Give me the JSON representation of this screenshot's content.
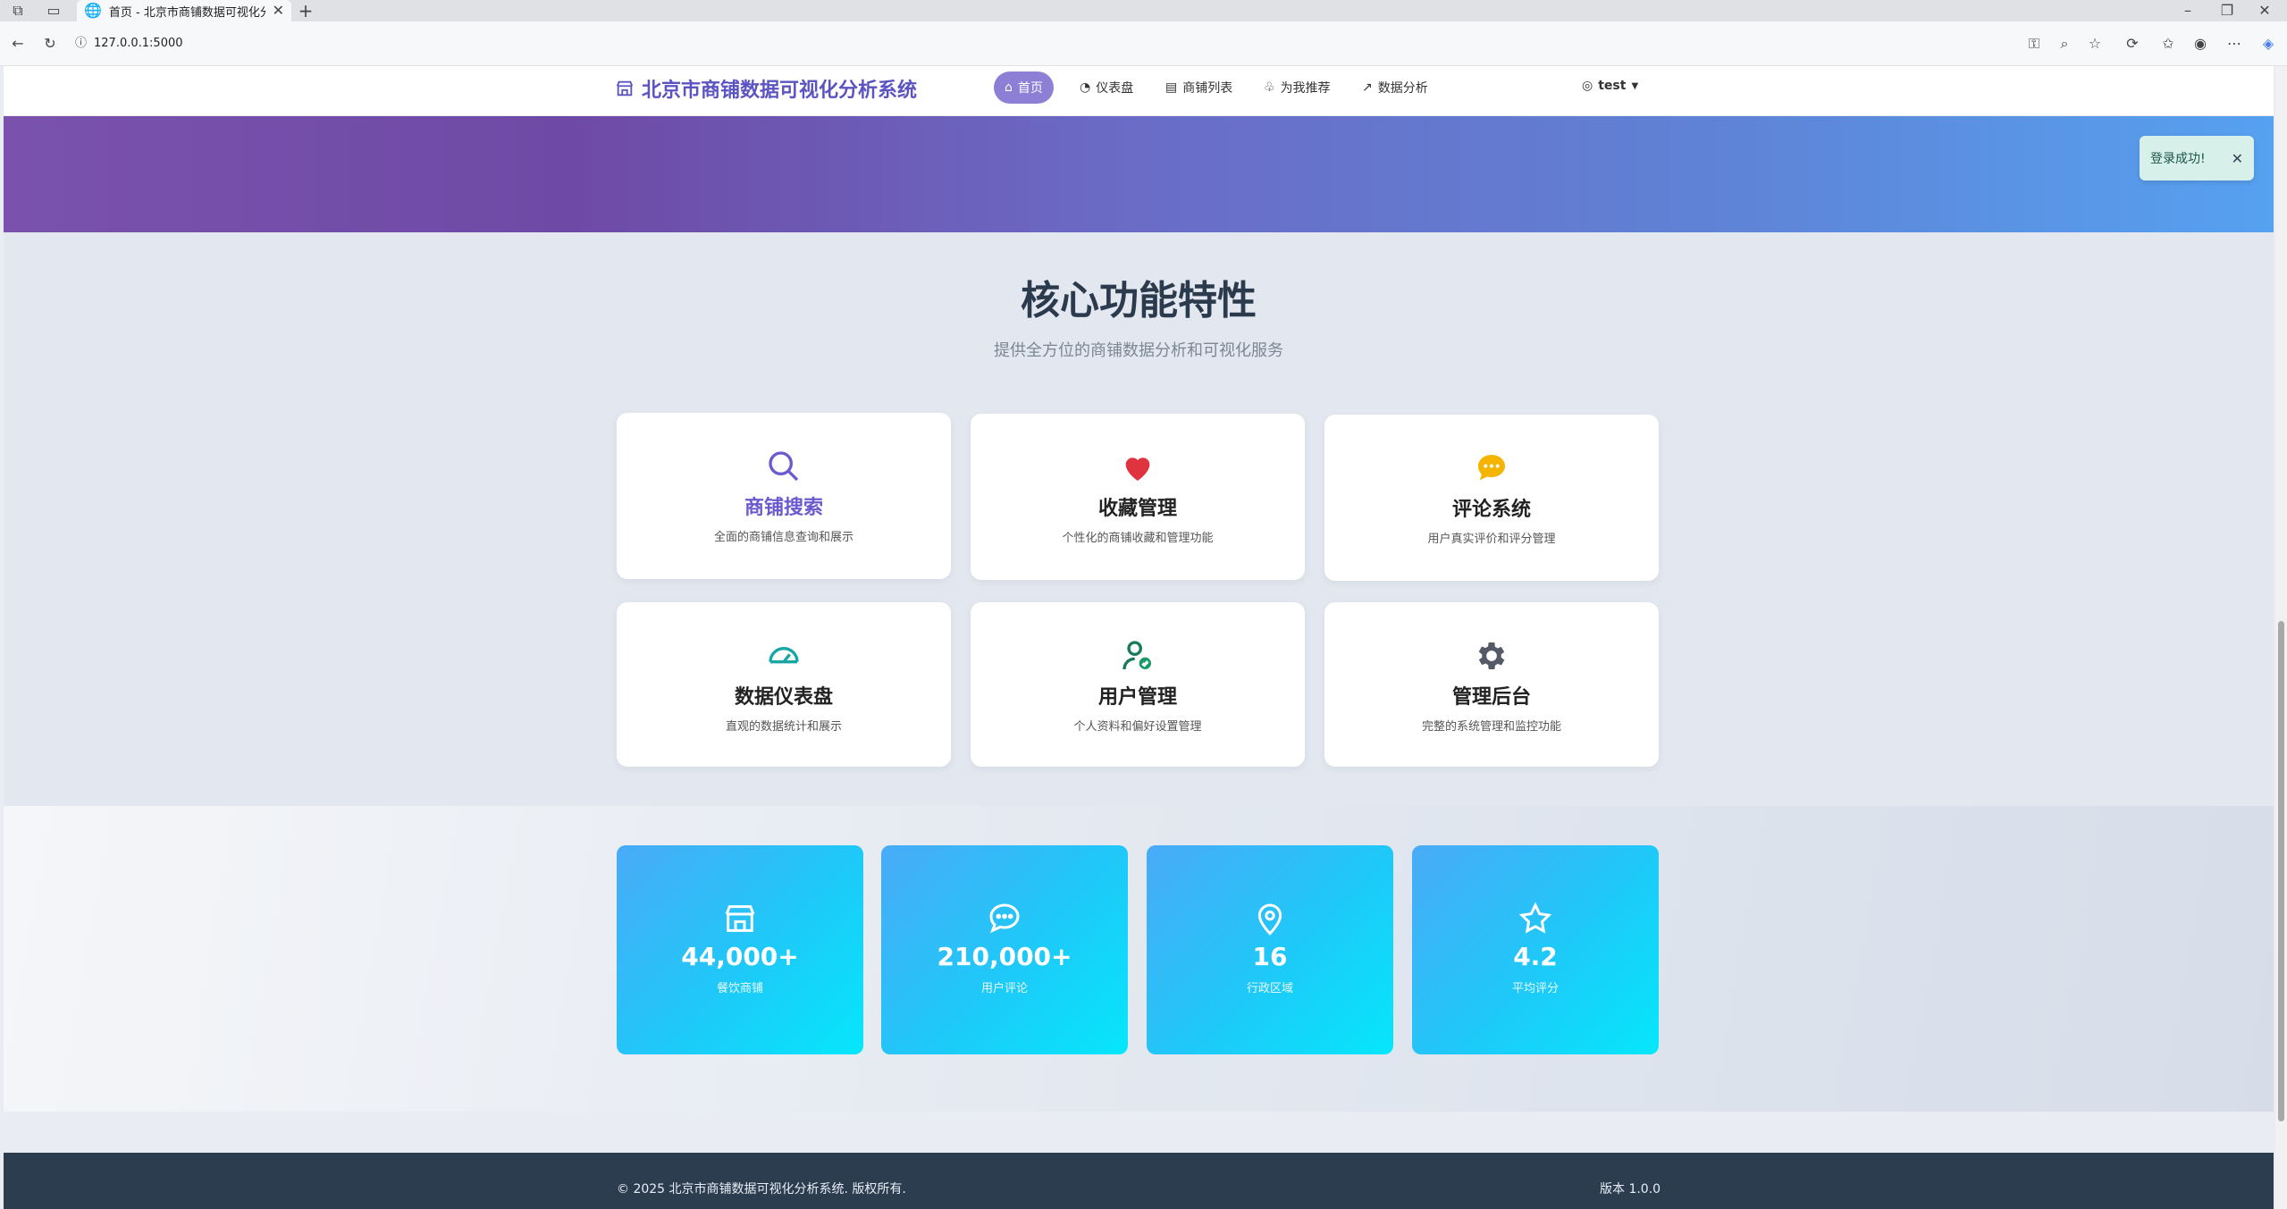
{
  "browser": {
    "tab_title": "首页 - 北京市商铺数据可视化分析",
    "url": "127.0.0.1:5000"
  },
  "navbar": {
    "brand": "北京市商铺数据可视化分析系统",
    "items": [
      {
        "label": "首页",
        "icon": "home-icon"
      },
      {
        "label": "仪表盘",
        "icon": "gauge-icon"
      },
      {
        "label": "商铺列表",
        "icon": "shop-icon"
      },
      {
        "label": "为我推荐",
        "icon": "bulb-icon"
      },
      {
        "label": "数据分析",
        "icon": "chart-icon"
      }
    ],
    "user": "test"
  },
  "toast": {
    "message": "登录成功!"
  },
  "features": {
    "title": "核心功能特性",
    "subtitle": "提供全方位的商铺数据分析和可视化服务",
    "cards": [
      {
        "title": "商铺搜索",
        "desc": "全面的商铺信息查询和展示",
        "icon": "search-icon",
        "color": "#6a5ad0"
      },
      {
        "title": "收藏管理",
        "desc": "个性化的商铺收藏和管理功能",
        "icon": "heart-icon",
        "color": "#e03340"
      },
      {
        "title": "评论系统",
        "desc": "用户真实评价和评分管理",
        "icon": "chat-icon",
        "color": "#f5b400"
      },
      {
        "title": "数据仪表盘",
        "desc": "直观的数据统计和展示",
        "icon": "speedometer-icon",
        "color": "#17a5a5"
      },
      {
        "title": "用户管理",
        "desc": "个人资料和偏好设置管理",
        "icon": "user-check-icon",
        "color": "#1a9a6a"
      },
      {
        "title": "管理后台",
        "desc": "完整的系统管理和监控功能",
        "icon": "gear-icon",
        "color": "#555b66"
      }
    ]
  },
  "stats": [
    {
      "value": "44,000+",
      "label": "餐饮商铺",
      "icon": "shop-icon"
    },
    {
      "value": "210,000+",
      "label": "用户评论",
      "icon": "chat-icon"
    },
    {
      "value": "16",
      "label": "行政区域",
      "icon": "location-icon"
    },
    {
      "value": "4.2",
      "label": "平均评分",
      "icon": "star-icon"
    }
  ],
  "footer": {
    "copyright": "© 2025 北京市商铺数据可视化分析系统. 版权所有.",
    "version": "版本 1.0.0"
  }
}
